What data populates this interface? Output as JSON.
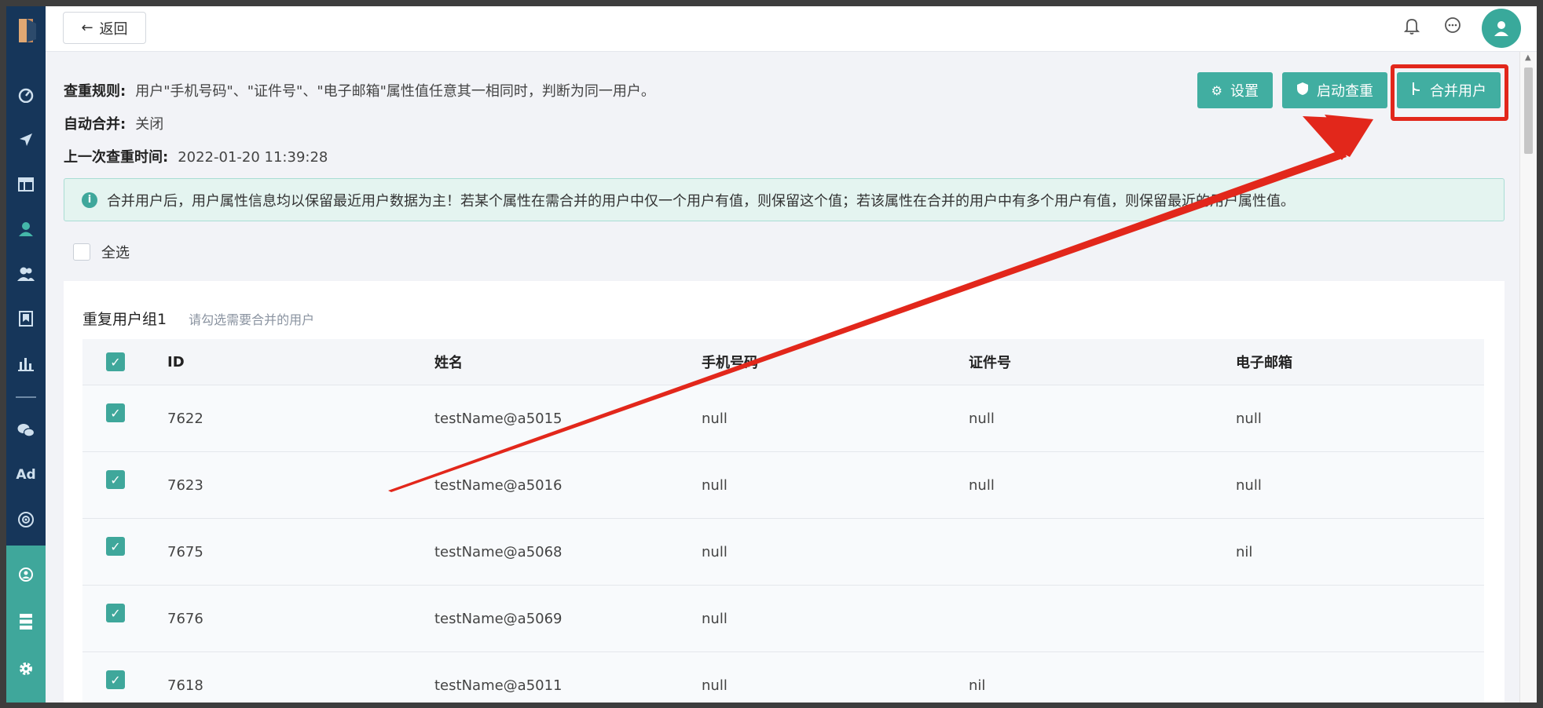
{
  "topbar": {
    "back_label": "返回"
  },
  "rules": {
    "dedupe_label": "查重规则:",
    "dedupe_value": "用户\"手机号码\"、\"证件号\"、\"电子邮箱\"属性值任意其一相同时，判断为同一用户。",
    "auto_merge_label": "自动合并:",
    "auto_merge_value": "关闭",
    "last_check_label": "上一次查重时间:",
    "last_check_value": "2022-01-20 11:39:28"
  },
  "actions": {
    "settings_label": "设置",
    "start_label": "启动查重",
    "merge_label": "合并用户"
  },
  "tip": "合并用户后，用户属性信息均以保留最近用户数据为主！若某个属性在需合并的用户中仅一个用户有值，则保留这个值；若该属性在合并的用户中有多个用户有值，则保留最近的用户属性值。",
  "select_all_label": "全选",
  "group": {
    "title": "重复用户组1",
    "hint": "请勾选需要合并的用户",
    "columns": [
      "ID",
      "姓名",
      "手机号码",
      "证件号",
      "电子邮箱"
    ],
    "rows": [
      {
        "id": "7622",
        "name": "testName@a5015",
        "phone": "null",
        "cert": "null",
        "email": "null"
      },
      {
        "id": "7623",
        "name": "testName@a5016",
        "phone": "null",
        "cert": "null",
        "email": "null"
      },
      {
        "id": "7675",
        "name": "testName@a5068",
        "phone": "null",
        "cert": "",
        "email": "nil"
      },
      {
        "id": "7676",
        "name": "testName@a5069",
        "phone": "null",
        "cert": "",
        "email": ""
      },
      {
        "id": "7618",
        "name": "testName@a5011",
        "phone": "null",
        "cert": "nil",
        "email": ""
      }
    ]
  },
  "colors": {
    "primary": "#41aea1",
    "sidebar": "#16365a",
    "annotation": "#e2271b"
  }
}
